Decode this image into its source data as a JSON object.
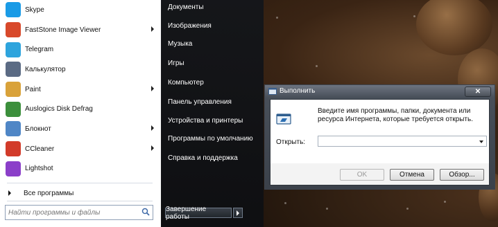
{
  "start_menu": {
    "pinned": [
      {
        "label": "Skype",
        "icon": "skype-icon",
        "color": "#1a9be6",
        "submenu": false
      },
      {
        "label": "FastStone Image Viewer",
        "icon": "faststone-icon",
        "color": "#d8492b",
        "submenu": true
      },
      {
        "label": "Telegram",
        "icon": "telegram-icon",
        "color": "#2ea4dd",
        "submenu": false
      },
      {
        "label": "Калькулятор",
        "icon": "calculator-icon",
        "color": "#5b6b84",
        "submenu": false
      },
      {
        "label": "Paint",
        "icon": "paint-icon",
        "color": "#d9a23a",
        "submenu": true
      },
      {
        "label": "Auslogics Disk Defrag",
        "icon": "defrag-icon",
        "color": "#3c8f3c",
        "submenu": false
      },
      {
        "label": "Блокнот",
        "icon": "notepad-icon",
        "color": "#4f86c6",
        "submenu": true
      },
      {
        "label": "CCleaner",
        "icon": "ccleaner-icon",
        "color": "#d23b2a",
        "submenu": true
      },
      {
        "label": "Lightshot",
        "icon": "lightshot-icon",
        "color": "#8b3fc9",
        "submenu": false
      }
    ],
    "all_programs": "Все программы",
    "search_placeholder": "Найти программы и файлы",
    "places": [
      "Документы",
      "Изображения",
      "Музыка",
      "Игры",
      "Компьютер",
      "Панель управления",
      "Устройства и принтеры",
      "Программы по умолчанию",
      "Справка и поддержка"
    ],
    "shutdown_label": "Завершение работы"
  },
  "run_dialog": {
    "title": "Выполнить",
    "close": "✕",
    "description": "Введите имя программы, папки, документа или ресурса Интернета, которые требуется открыть.",
    "open_label": "Открыть:",
    "open_value": "",
    "buttons": {
      "ok": "OK",
      "cancel": "Отмена",
      "browse": "Обзор..."
    }
  }
}
